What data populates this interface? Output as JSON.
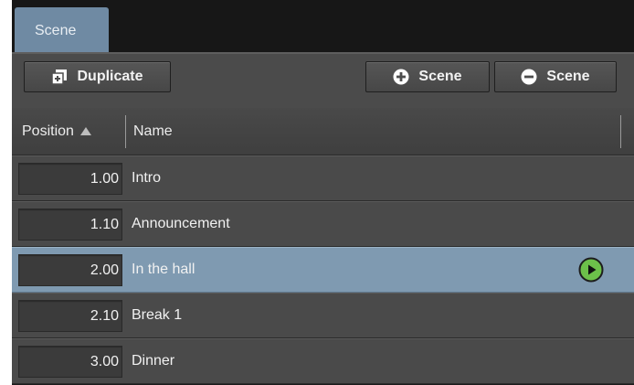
{
  "tab": {
    "label": "Scene"
  },
  "toolbar": {
    "duplicate_label": "Duplicate",
    "add_scene_label": "Scene",
    "remove_scene_label": "Scene"
  },
  "table": {
    "columns": [
      "Position",
      "Name"
    ],
    "sort": {
      "column": "Position",
      "direction": "ascending"
    },
    "rows": [
      {
        "position": "1.00",
        "name": "Intro",
        "selected": false
      },
      {
        "position": "1.10",
        "name": "Announcement",
        "selected": false
      },
      {
        "position": "2.00",
        "name": "In the hall",
        "selected": true
      },
      {
        "position": "2.10",
        "name": "Break 1",
        "selected": false
      },
      {
        "position": "3.00",
        "name": "Dinner",
        "selected": false
      }
    ]
  },
  "icons": {
    "duplicate": "duplicate-icon",
    "add": "plus-circle-icon",
    "remove": "minus-circle-icon",
    "play": "play-icon",
    "sort": "sort-ascending-icon"
  },
  "colors": {
    "tab_active": "#6f8aa3",
    "selected_row": "#7f9ab1",
    "play_green": "#6cc04a"
  }
}
